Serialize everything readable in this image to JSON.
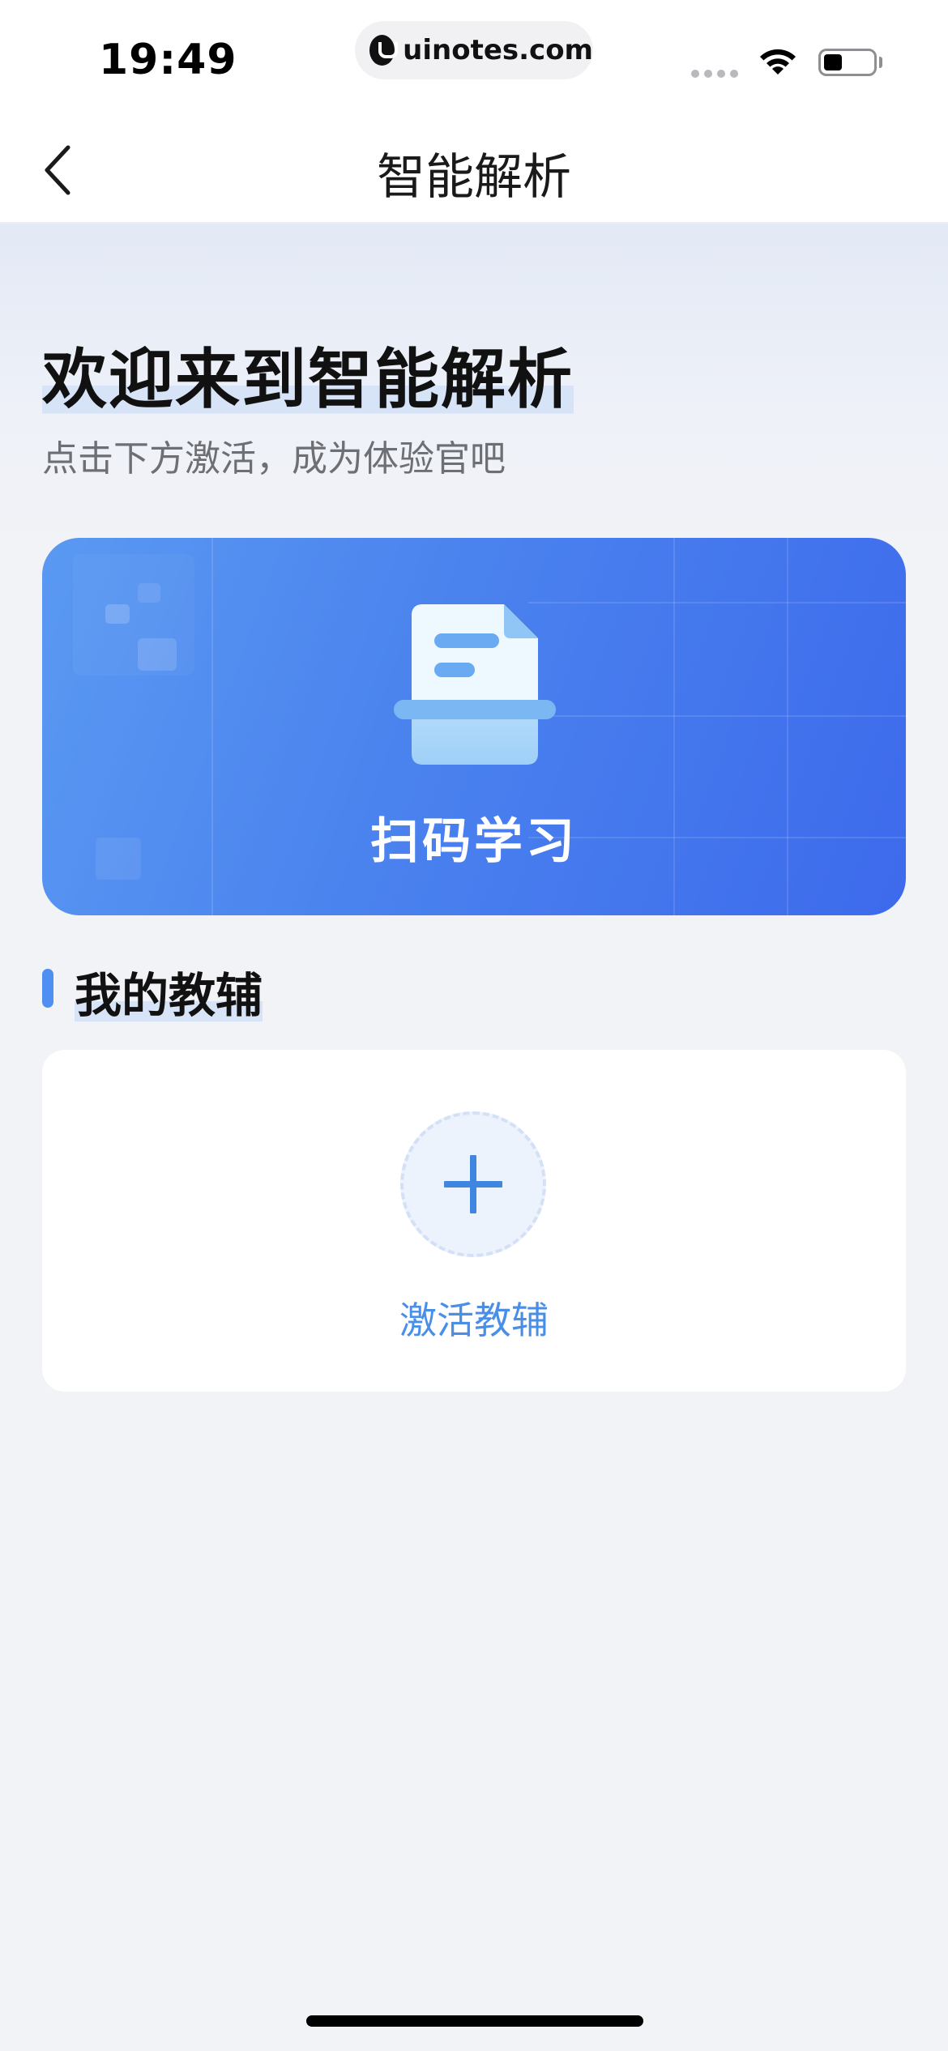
{
  "status_bar": {
    "time": "19:49",
    "url": "uinotes.com"
  },
  "nav": {
    "title": "智能解析",
    "back_icon": "chevron-left-icon"
  },
  "welcome": {
    "title": "欢迎来到智能解析",
    "subtitle": "点击下方激活，成为体验官吧"
  },
  "scan_card": {
    "label": "扫码学习",
    "icon": "document-scan-icon"
  },
  "tutor_section": {
    "title": "我的教辅",
    "add_label": "激活教辅",
    "add_icon": "plus-icon"
  },
  "colors": {
    "accent": "#4a8fe7",
    "card_gradient_start": "#5a99f2",
    "card_gradient_end": "#3d6aec",
    "background": "#f2f3f6"
  }
}
